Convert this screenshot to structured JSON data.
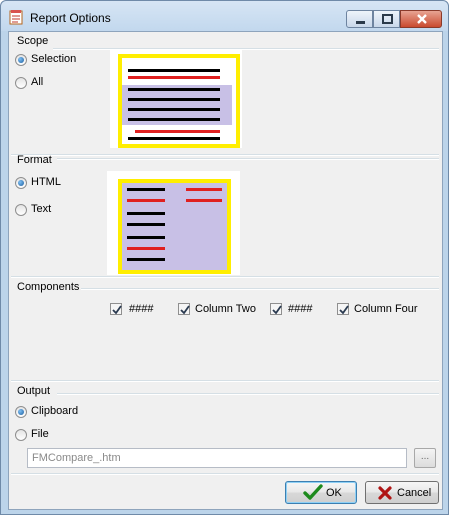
{
  "window": {
    "title": "Report Options"
  },
  "scope": {
    "label": "Scope",
    "options": [
      {
        "label": "Selection",
        "checked": true
      },
      {
        "label": "All",
        "checked": false
      }
    ]
  },
  "format": {
    "label": "Format",
    "options": [
      {
        "label": "HTML",
        "checked": true
      },
      {
        "label": "Text",
        "checked": false
      }
    ]
  },
  "components": {
    "label": "Components",
    "items": [
      {
        "label": "####",
        "checked": true
      },
      {
        "label": "Column Two",
        "checked": true
      },
      {
        "label": "####",
        "checked": true
      },
      {
        "label": "Column Four",
        "checked": true
      }
    ]
  },
  "output": {
    "label": "Output",
    "options": [
      {
        "label": "Clipboard",
        "checked": true
      },
      {
        "label": "File",
        "checked": false
      }
    ],
    "file_path": "FMCompare_.htm",
    "browse_label": "..."
  },
  "buttons": {
    "ok": "OK",
    "cancel": "Cancel"
  },
  "colors": {
    "highlight_border": "#ffee00",
    "selection_fill": "#c8c0e6",
    "text_line": "#000000",
    "accent_line": "#e02020"
  }
}
